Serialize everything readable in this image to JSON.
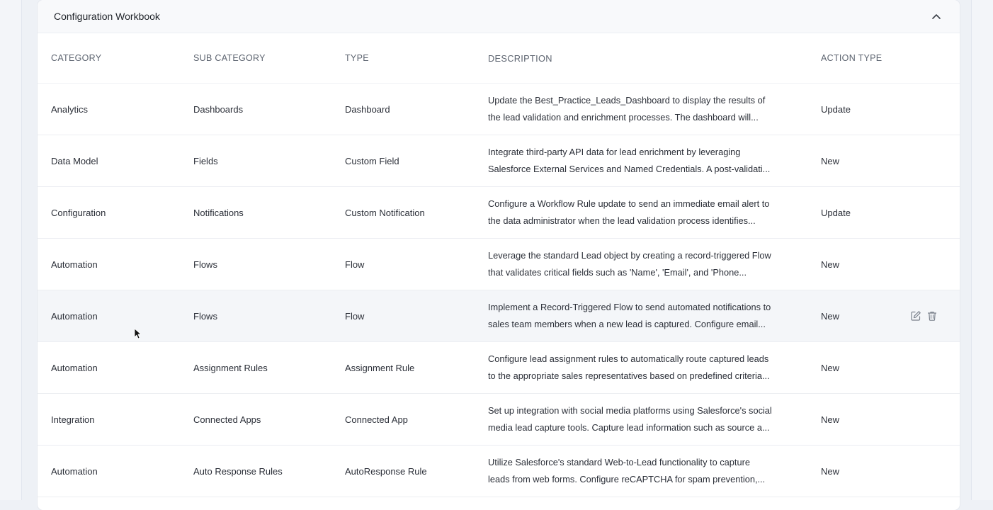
{
  "card": {
    "title": "Configuration Workbook"
  },
  "icons": {
    "collapse": "chevron-up-icon",
    "edit": "edit-icon",
    "delete": "trash-icon",
    "cursor": "mouse-pointer-icon"
  },
  "colors": {
    "background": "#eef1f6",
    "card": "#ffffff",
    "header": "#f8f9fb",
    "row_hover": "#f4f6f9",
    "text": "#2b2f38",
    "muted": "#5d6470",
    "icon": "#7a818c"
  },
  "table": {
    "columns": {
      "category": "CATEGORY",
      "sub_category": "SUB CATEGORY",
      "type": "TYPE",
      "description": "DESCRIPTION",
      "action_type": "ACTION TYPE"
    },
    "rows": [
      {
        "category": "Analytics",
        "sub_category": "Dashboards",
        "type": "Dashboard",
        "description_line1": "Update the Best_Practice_Leads_Dashboard to display the results of",
        "description_line2": "the lead validation and enrichment processes. The dashboard will...",
        "action_type": "Update"
      },
      {
        "category": "Data Model",
        "sub_category": "Fields",
        "type": "Custom Field",
        "description_line1": "Integrate third-party API data for lead enrichment by leveraging",
        "description_line2": "Salesforce External Services and Named Credentials. A post-validati...",
        "action_type": "New"
      },
      {
        "category": "Configuration",
        "sub_category": "Notifications",
        "type": "Custom Notification",
        "description_line1": "Configure a Workflow Rule update to send an immediate email alert to",
        "description_line2": "the data administrator when the lead validation process identifies...",
        "action_type": "Update"
      },
      {
        "category": "Automation",
        "sub_category": "Flows",
        "type": "Flow",
        "description_line1": "Leverage the standard Lead object by creating a record-triggered Flow",
        "description_line2": "that validates critical fields such as 'Name', 'Email', and 'Phone...",
        "action_type": "New"
      },
      {
        "category": "Automation",
        "sub_category": "Flows",
        "type": "Flow",
        "description_line1": "Implement a Record-Triggered Flow to send automated notifications to",
        "description_line2": "sales team members when a new lead is captured. Configure email...",
        "action_type": "New"
      },
      {
        "category": "Automation",
        "sub_category": "Assignment Rules",
        "type": "Assignment Rule",
        "description_line1": "Configure lead assignment rules to automatically route captured leads",
        "description_line2": "to the appropriate sales representatives based on predefined criteria...",
        "action_type": "New"
      },
      {
        "category": "Integration",
        "sub_category": "Connected Apps",
        "type": "Connected App",
        "description_line1": "Set up integration with social media platforms using Salesforce's social",
        "description_line2": "media lead capture tools. Capture lead information such as source a...",
        "action_type": "New"
      },
      {
        "category": "Automation",
        "sub_category": "Auto Response Rules",
        "type": "AutoResponse Rule",
        "description_line1": "Utilize Salesforce's standard Web-to-Lead functionality to capture",
        "description_line2": "leads from web forms. Configure reCAPTCHA for spam prevention,...",
        "action_type": "New"
      }
    ]
  }
}
